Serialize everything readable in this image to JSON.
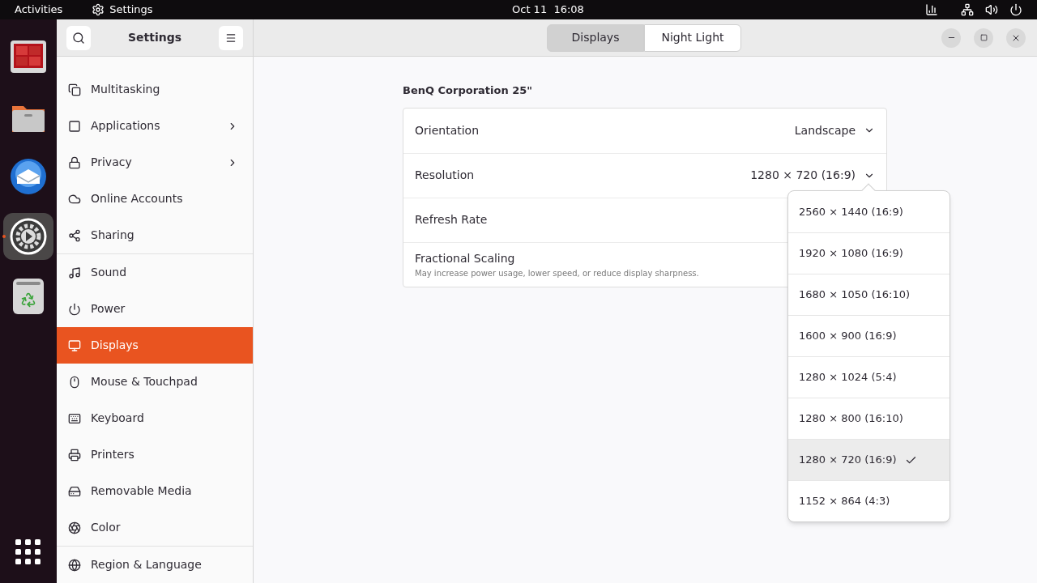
{
  "top_bar": {
    "activities": "Activities",
    "app_name": "Settings",
    "clock": "Oct 11  16:08"
  },
  "dock": [
    {
      "kind": "workspace",
      "active": false
    },
    {
      "kind": "files",
      "active": false
    },
    {
      "kind": "mail",
      "active": false
    },
    {
      "kind": "settings",
      "active": true
    },
    {
      "kind": "trash",
      "active": false
    }
  ],
  "sidebar": {
    "title": "Settings",
    "items": [
      {
        "label": "Multitasking",
        "selected": false,
        "submenu": false
      },
      {
        "label": "Applications",
        "selected": false,
        "submenu": true
      },
      {
        "label": "Privacy",
        "selected": false,
        "submenu": true
      },
      {
        "label": "Online Accounts",
        "selected": false,
        "submenu": false
      },
      {
        "label": "Sharing",
        "selected": false,
        "submenu": false
      },
      {
        "label": "Sound",
        "selected": false,
        "submenu": false
      },
      {
        "label": "Power",
        "selected": false,
        "submenu": false
      },
      {
        "label": "Displays",
        "selected": true,
        "submenu": false
      },
      {
        "label": "Mouse & Touchpad",
        "selected": false,
        "submenu": false
      },
      {
        "label": "Keyboard",
        "selected": false,
        "submenu": false
      },
      {
        "label": "Printers",
        "selected": false,
        "submenu": false
      },
      {
        "label": "Removable Media",
        "selected": false,
        "submenu": false
      },
      {
        "label": "Color",
        "selected": false,
        "submenu": false
      },
      {
        "label": "Region & Language",
        "selected": false,
        "submenu": false
      }
    ]
  },
  "tabs": [
    {
      "label": "Displays",
      "selected": true
    },
    {
      "label": "Night Light",
      "selected": false
    }
  ],
  "monitor": {
    "name": "BenQ Corporation 25\"",
    "rows": [
      {
        "label": "Orientation",
        "value": "Landscape"
      },
      {
        "label": "Resolution",
        "value": "1280 × 720 (16:9)"
      },
      {
        "label": "Refresh Rate"
      },
      {
        "label": "Fractional Scaling",
        "subtitle": "May increase power usage, lower speed, or reduce display sharpness."
      }
    ]
  },
  "resolution_menu": [
    {
      "label": "2560 × 1440 (16:9)",
      "selected": false
    },
    {
      "label": "1920 × 1080 (16:9)",
      "selected": false
    },
    {
      "label": "1680 × 1050 (16:10)",
      "selected": false
    },
    {
      "label": "1600 × 900 (16:9)",
      "selected": false
    },
    {
      "label": "1280 × 1024 (5:4)",
      "selected": false
    },
    {
      "label": "1280 × 800 (16:10)",
      "selected": false
    },
    {
      "label": "1280 × 720 (16:9)",
      "selected": true
    },
    {
      "label": "1152 × 864 (4:3)",
      "selected": false
    }
  ]
}
